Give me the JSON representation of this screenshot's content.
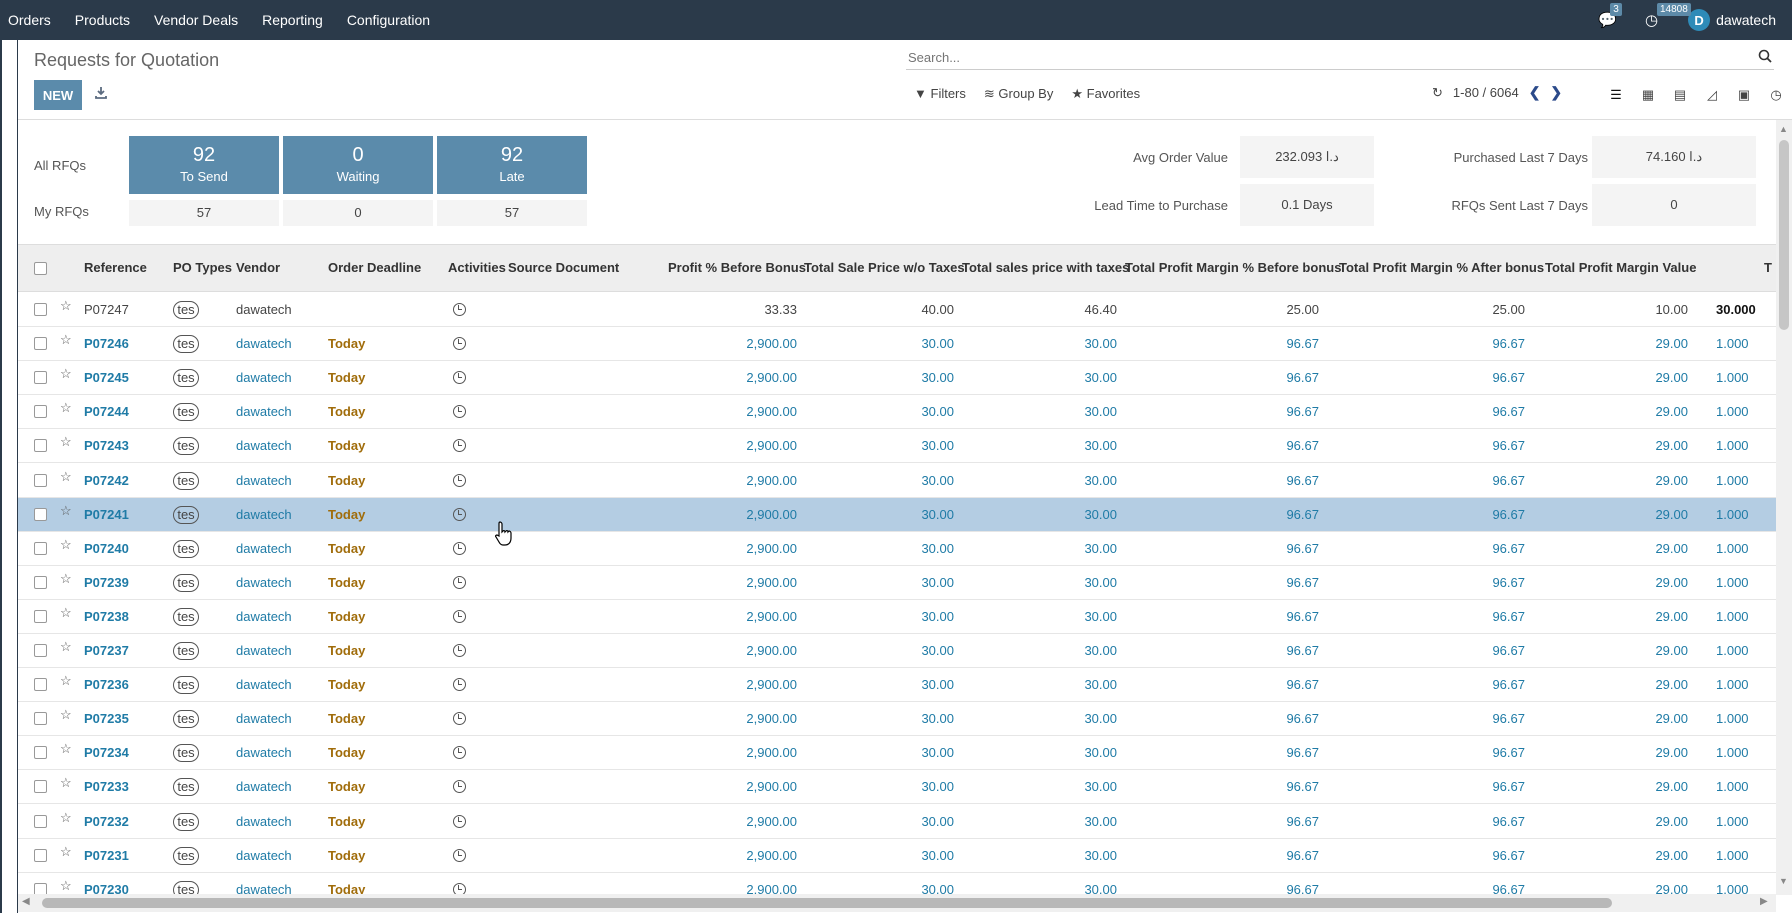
{
  "topnav": {
    "menu": [
      "Orders",
      "Products",
      "Vendor Deals",
      "Reporting",
      "Configuration"
    ],
    "messages_count": "3",
    "activities_count": "14808",
    "user_initial": "D",
    "user_name": "dawatech"
  },
  "control_panel": {
    "title": "Requests for Quotation",
    "new_label": "NEW",
    "search_placeholder": "Search...",
    "filters_label": "Filters",
    "groupby_label": "Group By",
    "favorites_label": "Favorites",
    "pager": "1-80 / 6064"
  },
  "dashboard": {
    "all_rfqs_label": "All RFQs",
    "my_rfqs_label": "My RFQs",
    "tiles": [
      {
        "number": "92",
        "label": "To Send",
        "mine": "57"
      },
      {
        "number": "0",
        "label": "Waiting",
        "mine": "0"
      },
      {
        "number": "92",
        "label": "Late",
        "mine": "57"
      }
    ],
    "kpis": {
      "avg_order_value_label": "Avg Order Value",
      "avg_order_value": "232.093  د.ا",
      "lead_time_label": "Lead Time to Purchase",
      "lead_time": "0.1 Days",
      "purchased_label": "Purchased Last 7 Days",
      "purchased": "74.160  د.ا",
      "rfqs_sent_label": "RFQs Sent Last 7 Days",
      "rfqs_sent": "0"
    }
  },
  "table": {
    "columns": [
      "Reference",
      "PO Types",
      "Vendor",
      "Order Deadline",
      "Activities",
      "Source Document",
      "Profit % Before Bonus",
      "Total Sale Price w/o Taxes",
      "Total sales price with taxes",
      "Total Profit Margin % Before bonus",
      "Total Profit Margin % After bonus",
      "Total Profit Margin Value",
      "T"
    ],
    "rows": [
      {
        "ref": "P07247",
        "type": "tes",
        "vendor": "dawatech",
        "deadline": "",
        "profit": "33.33",
        "sale_wo": "40.00",
        "sale_w": "46.40",
        "pm_before": "25.00",
        "pm_after": "25.00",
        "pm_value": "10.00",
        "t": "30.000"
      },
      {
        "ref": "P07246",
        "type": "tes",
        "vendor": "dawatech",
        "deadline": "Today",
        "profit": "2,900.00",
        "sale_wo": "30.00",
        "sale_w": "30.00",
        "pm_before": "96.67",
        "pm_after": "96.67",
        "pm_value": "29.00",
        "t": "1.000"
      },
      {
        "ref": "P07245",
        "type": "tes",
        "vendor": "dawatech",
        "deadline": "Today",
        "profit": "2,900.00",
        "sale_wo": "30.00",
        "sale_w": "30.00",
        "pm_before": "96.67",
        "pm_after": "96.67",
        "pm_value": "29.00",
        "t": "1.000"
      },
      {
        "ref": "P07244",
        "type": "tes",
        "vendor": "dawatech",
        "deadline": "Today",
        "profit": "2,900.00",
        "sale_wo": "30.00",
        "sale_w": "30.00",
        "pm_before": "96.67",
        "pm_after": "96.67",
        "pm_value": "29.00",
        "t": "1.000"
      },
      {
        "ref": "P07243",
        "type": "tes",
        "vendor": "dawatech",
        "deadline": "Today",
        "profit": "2,900.00",
        "sale_wo": "30.00",
        "sale_w": "30.00",
        "pm_before": "96.67",
        "pm_after": "96.67",
        "pm_value": "29.00",
        "t": "1.000"
      },
      {
        "ref": "P07242",
        "type": "tes",
        "vendor": "dawatech",
        "deadline": "Today",
        "profit": "2,900.00",
        "sale_wo": "30.00",
        "sale_w": "30.00",
        "pm_before": "96.67",
        "pm_after": "96.67",
        "pm_value": "29.00",
        "t": "1.000"
      },
      {
        "ref": "P07241",
        "type": "tes",
        "vendor": "dawatech",
        "deadline": "Today",
        "profit": "2,900.00",
        "sale_wo": "30.00",
        "sale_w": "30.00",
        "pm_before": "96.67",
        "pm_after": "96.67",
        "pm_value": "29.00",
        "t": "1.000"
      },
      {
        "ref": "P07240",
        "type": "tes",
        "vendor": "dawatech",
        "deadline": "Today",
        "profit": "2,900.00",
        "sale_wo": "30.00",
        "sale_w": "30.00",
        "pm_before": "96.67",
        "pm_after": "96.67",
        "pm_value": "29.00",
        "t": "1.000"
      },
      {
        "ref": "P07239",
        "type": "tes",
        "vendor": "dawatech",
        "deadline": "Today",
        "profit": "2,900.00",
        "sale_wo": "30.00",
        "sale_w": "30.00",
        "pm_before": "96.67",
        "pm_after": "96.67",
        "pm_value": "29.00",
        "t": "1.000"
      },
      {
        "ref": "P07238",
        "type": "tes",
        "vendor": "dawatech",
        "deadline": "Today",
        "profit": "2,900.00",
        "sale_wo": "30.00",
        "sale_w": "30.00",
        "pm_before": "96.67",
        "pm_after": "96.67",
        "pm_value": "29.00",
        "t": "1.000"
      },
      {
        "ref": "P07237",
        "type": "tes",
        "vendor": "dawatech",
        "deadline": "Today",
        "profit": "2,900.00",
        "sale_wo": "30.00",
        "sale_w": "30.00",
        "pm_before": "96.67",
        "pm_after": "96.67",
        "pm_value": "29.00",
        "t": "1.000"
      },
      {
        "ref": "P07236",
        "type": "tes",
        "vendor": "dawatech",
        "deadline": "Today",
        "profit": "2,900.00",
        "sale_wo": "30.00",
        "sale_w": "30.00",
        "pm_before": "96.67",
        "pm_after": "96.67",
        "pm_value": "29.00",
        "t": "1.000"
      },
      {
        "ref": "P07235",
        "type": "tes",
        "vendor": "dawatech",
        "deadline": "Today",
        "profit": "2,900.00",
        "sale_wo": "30.00",
        "sale_w": "30.00",
        "pm_before": "96.67",
        "pm_after": "96.67",
        "pm_value": "29.00",
        "t": "1.000"
      },
      {
        "ref": "P07234",
        "type": "tes",
        "vendor": "dawatech",
        "deadline": "Today",
        "profit": "2,900.00",
        "sale_wo": "30.00",
        "sale_w": "30.00",
        "pm_before": "96.67",
        "pm_after": "96.67",
        "pm_value": "29.00",
        "t": "1.000"
      },
      {
        "ref": "P07233",
        "type": "tes",
        "vendor": "dawatech",
        "deadline": "Today",
        "profit": "2,900.00",
        "sale_wo": "30.00",
        "sale_w": "30.00",
        "pm_before": "96.67",
        "pm_after": "96.67",
        "pm_value": "29.00",
        "t": "1.000"
      },
      {
        "ref": "P07232",
        "type": "tes",
        "vendor": "dawatech",
        "deadline": "Today",
        "profit": "2,900.00",
        "sale_wo": "30.00",
        "sale_w": "30.00",
        "pm_before": "96.67",
        "pm_after": "96.67",
        "pm_value": "29.00",
        "t": "1.000"
      },
      {
        "ref": "P07231",
        "type": "tes",
        "vendor": "dawatech",
        "deadline": "Today",
        "profit": "2,900.00",
        "sale_wo": "30.00",
        "sale_w": "30.00",
        "pm_before": "96.67",
        "pm_after": "96.67",
        "pm_value": "29.00",
        "t": "1.000"
      },
      {
        "ref": "P07230",
        "type": "tes",
        "vendor": "dawatech",
        "deadline": "Today",
        "profit": "2,900.00",
        "sale_wo": "30.00",
        "sale_w": "30.00",
        "pm_before": "96.67",
        "pm_after": "96.67",
        "pm_value": "29.00",
        "t": "1.000"
      }
    ],
    "selected_ref": "P07241"
  },
  "colors": {
    "topbar": "#2b3a4a",
    "tile": "#5b8bab",
    "link": "#1f7ba6",
    "deadline": "#a06c0a",
    "selected_row": "#b4cde3"
  }
}
